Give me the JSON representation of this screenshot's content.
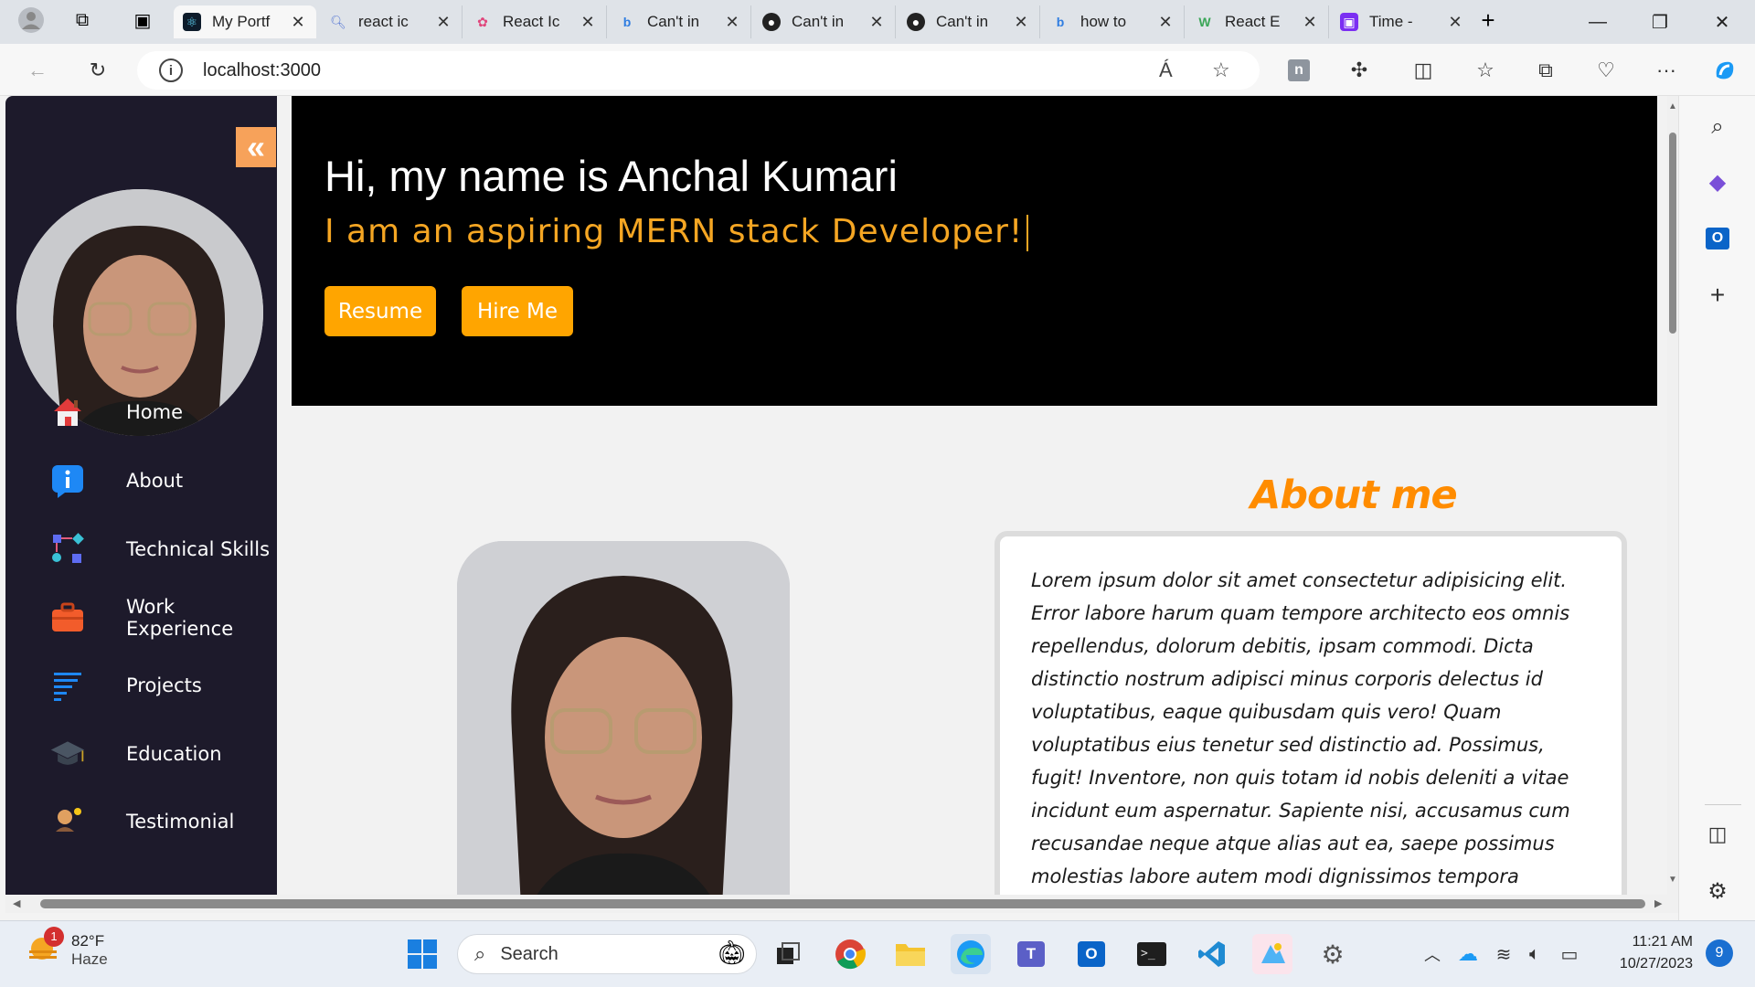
{
  "browser": {
    "tabs": [
      {
        "label": "My Portf",
        "active": true
      },
      {
        "label": "react ic"
      },
      {
        "label": "React Ic"
      },
      {
        "label": "Can't in"
      },
      {
        "label": "Can't in"
      },
      {
        "label": "Can't in"
      },
      {
        "label": "how to"
      },
      {
        "label": "React E"
      },
      {
        "label": "Time -"
      }
    ],
    "url": "localhost:3000",
    "read_aloud_icon": "Á",
    "favorites_icon": "star-icon"
  },
  "sidebar": {
    "collapse_icon": "«",
    "items": [
      {
        "label": "Home",
        "icon": "home-icon"
      },
      {
        "label": "About",
        "icon": "info-icon"
      },
      {
        "label": "Technical Skills",
        "icon": "skills-icon"
      },
      {
        "label": "Work Experience",
        "icon": "briefcase-icon"
      },
      {
        "label": "Projects",
        "icon": "projects-icon"
      },
      {
        "label": "Education",
        "icon": "graduation-cap-icon"
      },
      {
        "label": "Testimonial",
        "icon": "testimonial-icon"
      }
    ]
  },
  "hero": {
    "heading": "Hi, my name is Anchal Kumari",
    "subheading": "I am an aspiring MERN stack Developer!",
    "resume_label": "Resume",
    "hire_label": "Hire Me"
  },
  "about": {
    "title": "About me",
    "text": "Lorem ipsum dolor sit amet consectetur adipisicing elit. Error labore harum quam tempore architecto eos omnis repellendus, dolorum debitis, ipsam commodi. Dicta distinctio nostrum adipisci minus corporis delectus id voluptatibus, eaque quibusdam quis vero! Quam voluptatibus eius tenetur sed distinctio ad. Possimus, fugit! Inventore, non quis totam id nobis deleniti a vitae incidunt eum aspernatur. Sapiente nisi, accusamus cum recusandae neque atque alias aut ea, saepe possimus molestias labore autem modi dignissimos tempora explicabo? Consequuntur atque soluta ducimus facere voluptatibus officia dignissimos debitis, illo ratione"
  },
  "taskbar": {
    "weather_temp": "82°F",
    "weather_desc": "Haze",
    "weather_badge": "1",
    "search_label": "Search",
    "time": "11:21 AM",
    "date": "10/27/2023",
    "notification_count": "9"
  },
  "colors": {
    "sidebar_bg": "#1d1a2b",
    "accent_orange": "#ffa500",
    "title_orange": "#ff8c00",
    "hero_bg": "#000000"
  }
}
